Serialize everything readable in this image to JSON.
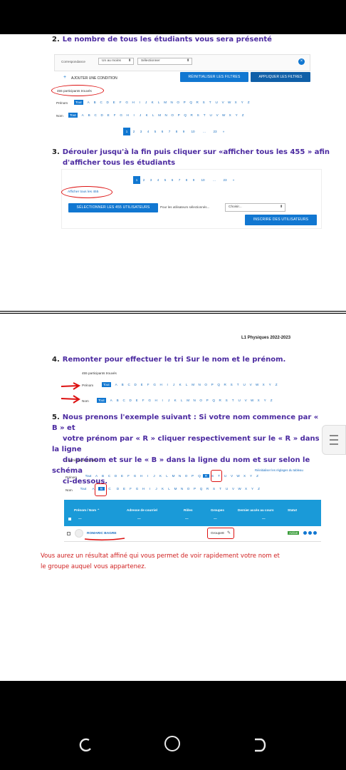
{
  "step2": {
    "num": "2.",
    "text": "Le nombre de tous les étudiants vous sera présenté"
  },
  "filters": {
    "label": "Correspondance",
    "match_select": "Un au moins",
    "select_placeholder": "Sélectionner",
    "add_condition": "AJOUTER UNE CONDITION",
    "reset_button": "RÉINITIALISER LES FILTRES",
    "apply_button": "APPLIQUER LES FILTRES"
  },
  "participants_found_455": "455 participants trouvés",
  "firstname_label": "Prénom",
  "lastname_label": "Nom",
  "all_label": "Tout",
  "letters": [
    "A",
    "B",
    "C",
    "D",
    "E",
    "F",
    "G",
    "H",
    "I",
    "J",
    "K",
    "L",
    "M",
    "N",
    "O",
    "P",
    "Q",
    "R",
    "S",
    "T",
    "U",
    "V",
    "W",
    "X",
    "Y",
    "Z"
  ],
  "pagination_top": [
    "1",
    "2",
    "3",
    "4",
    "5",
    "6",
    "7",
    "8",
    "9",
    "10",
    "...",
    "23",
    "»"
  ],
  "step3": {
    "num": "3.",
    "line1": "Dérouler jusqu'à la fin puis cliquer sur «afficher tous les 455 » afin",
    "line2": "d'afficher tous les étudiants"
  },
  "pagination_bottom": [
    "1",
    "2",
    "3",
    "4",
    "5",
    "6",
    "7",
    "8",
    "9",
    "10",
    "...",
    "23",
    "»"
  ],
  "show_all_link": "Afficher tous les 455",
  "select_all_users_button": "SÉLECTIONNER LES 455 UTILISATEURS",
  "for_selected_text": "Pour les utilisateurs sélectionnés...",
  "choose_select": "Choisir...",
  "enrol_button": "INSCRIRE DES UTILISATEURS",
  "header_right": "L1 Physiques 2022-2023",
  "step4": {
    "num": "4.",
    "text": "Remonter pour effectuer le tri Sur le nom et le prénom."
  },
  "step5": {
    "num": "5.",
    "line1": "Nous prenons l'exemple suivant : Si votre nom commence par « B » et",
    "line2": "votre prénom par « R » cliquer respectivement sur le « R » dans la ligne",
    "line3": "du prénom et sur le « B » dans la ligne du nom et sur selon le schéma",
    "line4": "ci-dessous."
  },
  "participants_found_1": "1 participants trouvés",
  "reset_table_prefs": "Réinitialiser les réglages du tableau",
  "table": {
    "headers": [
      "Prénom / Nom ⌃",
      "Adresse de courriel",
      "Rôles",
      "Groupes",
      "Dernier accès au cours",
      "Statut"
    ],
    "row": {
      "name": "ROMARIC BAGRE",
      "group": "Groupe8",
      "status": "Active"
    }
  },
  "result_note": {
    "line1": "Vous aurez un résultat affiné qui vous permet de voir rapidement votre nom et",
    "line2": "le groupe auquel vous appartenez."
  },
  "nav": {
    "back": "back-icon",
    "home": "home-icon",
    "recents": "recents-icon"
  },
  "colors": {
    "accent": "#1177d1",
    "step_text": "#4b2aa0",
    "annotation": "#d11111",
    "note_text": "#d02020"
  }
}
